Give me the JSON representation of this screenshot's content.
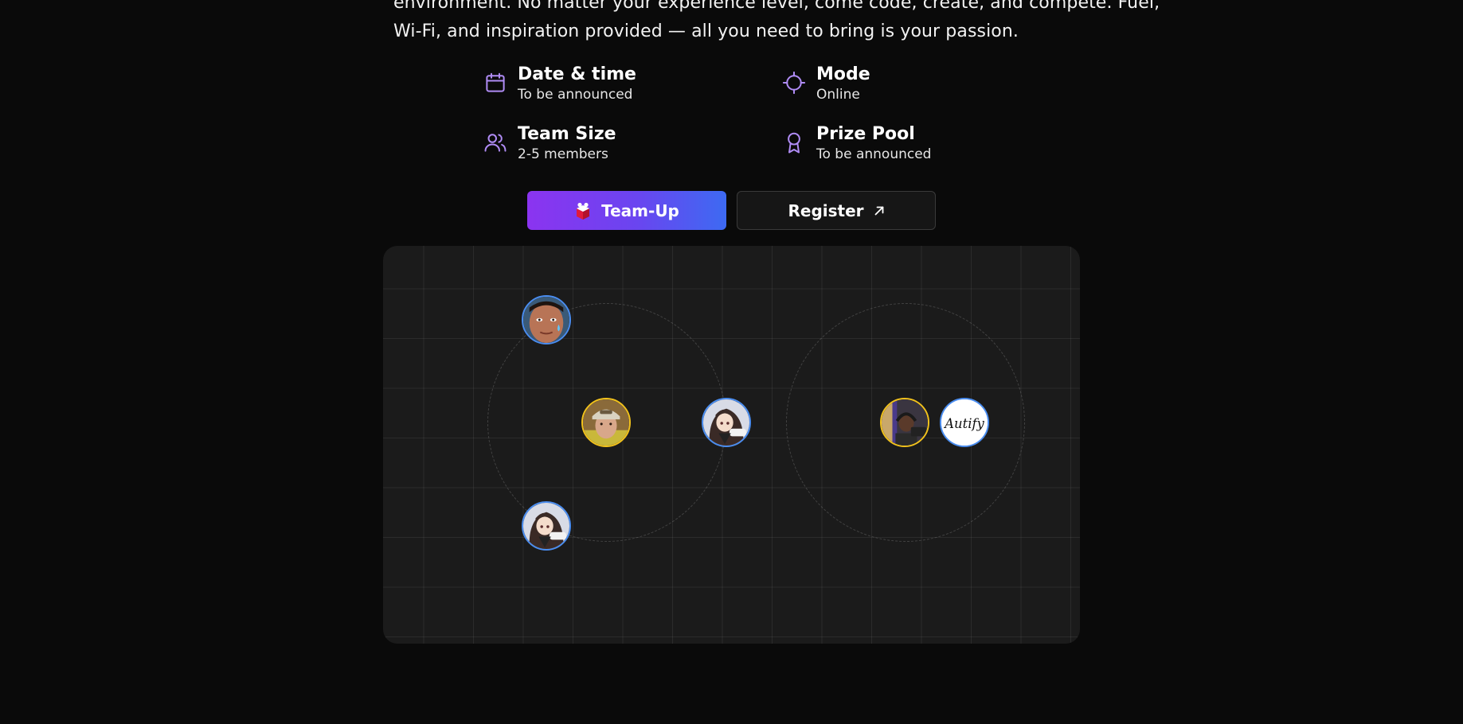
{
  "intro": {
    "line1": "environment. No matter your experience level, come code, create, and compete. Fuel,",
    "line2": "Wi-Fi, and inspiration provided — all you need to bring is your passion."
  },
  "info": {
    "date": {
      "title": "Date & time",
      "value": "To be announced",
      "icon": "calendar-icon"
    },
    "mode": {
      "title": "Mode",
      "value": "Online",
      "icon": "crosshair-icon"
    },
    "team": {
      "title": "Team Size",
      "value": "2-5 members",
      "icon": "users-icon"
    },
    "prize": {
      "title": "Prize Pool",
      "value": "To be announced",
      "icon": "award-icon"
    }
  },
  "buttons": {
    "teamup_label": "Team-Up",
    "register_label": "Register"
  },
  "avatars_logo_text": "Autify",
  "colors": {
    "accent_purple": "#8b34f0",
    "accent_blue": "#3d6af2",
    "icon_lavender": "#b08cf5",
    "ring_blue": "#4a8df0",
    "ring_gold": "#f2c21c",
    "background": "#0a0a0a",
    "panel": "#1b1b1b"
  }
}
